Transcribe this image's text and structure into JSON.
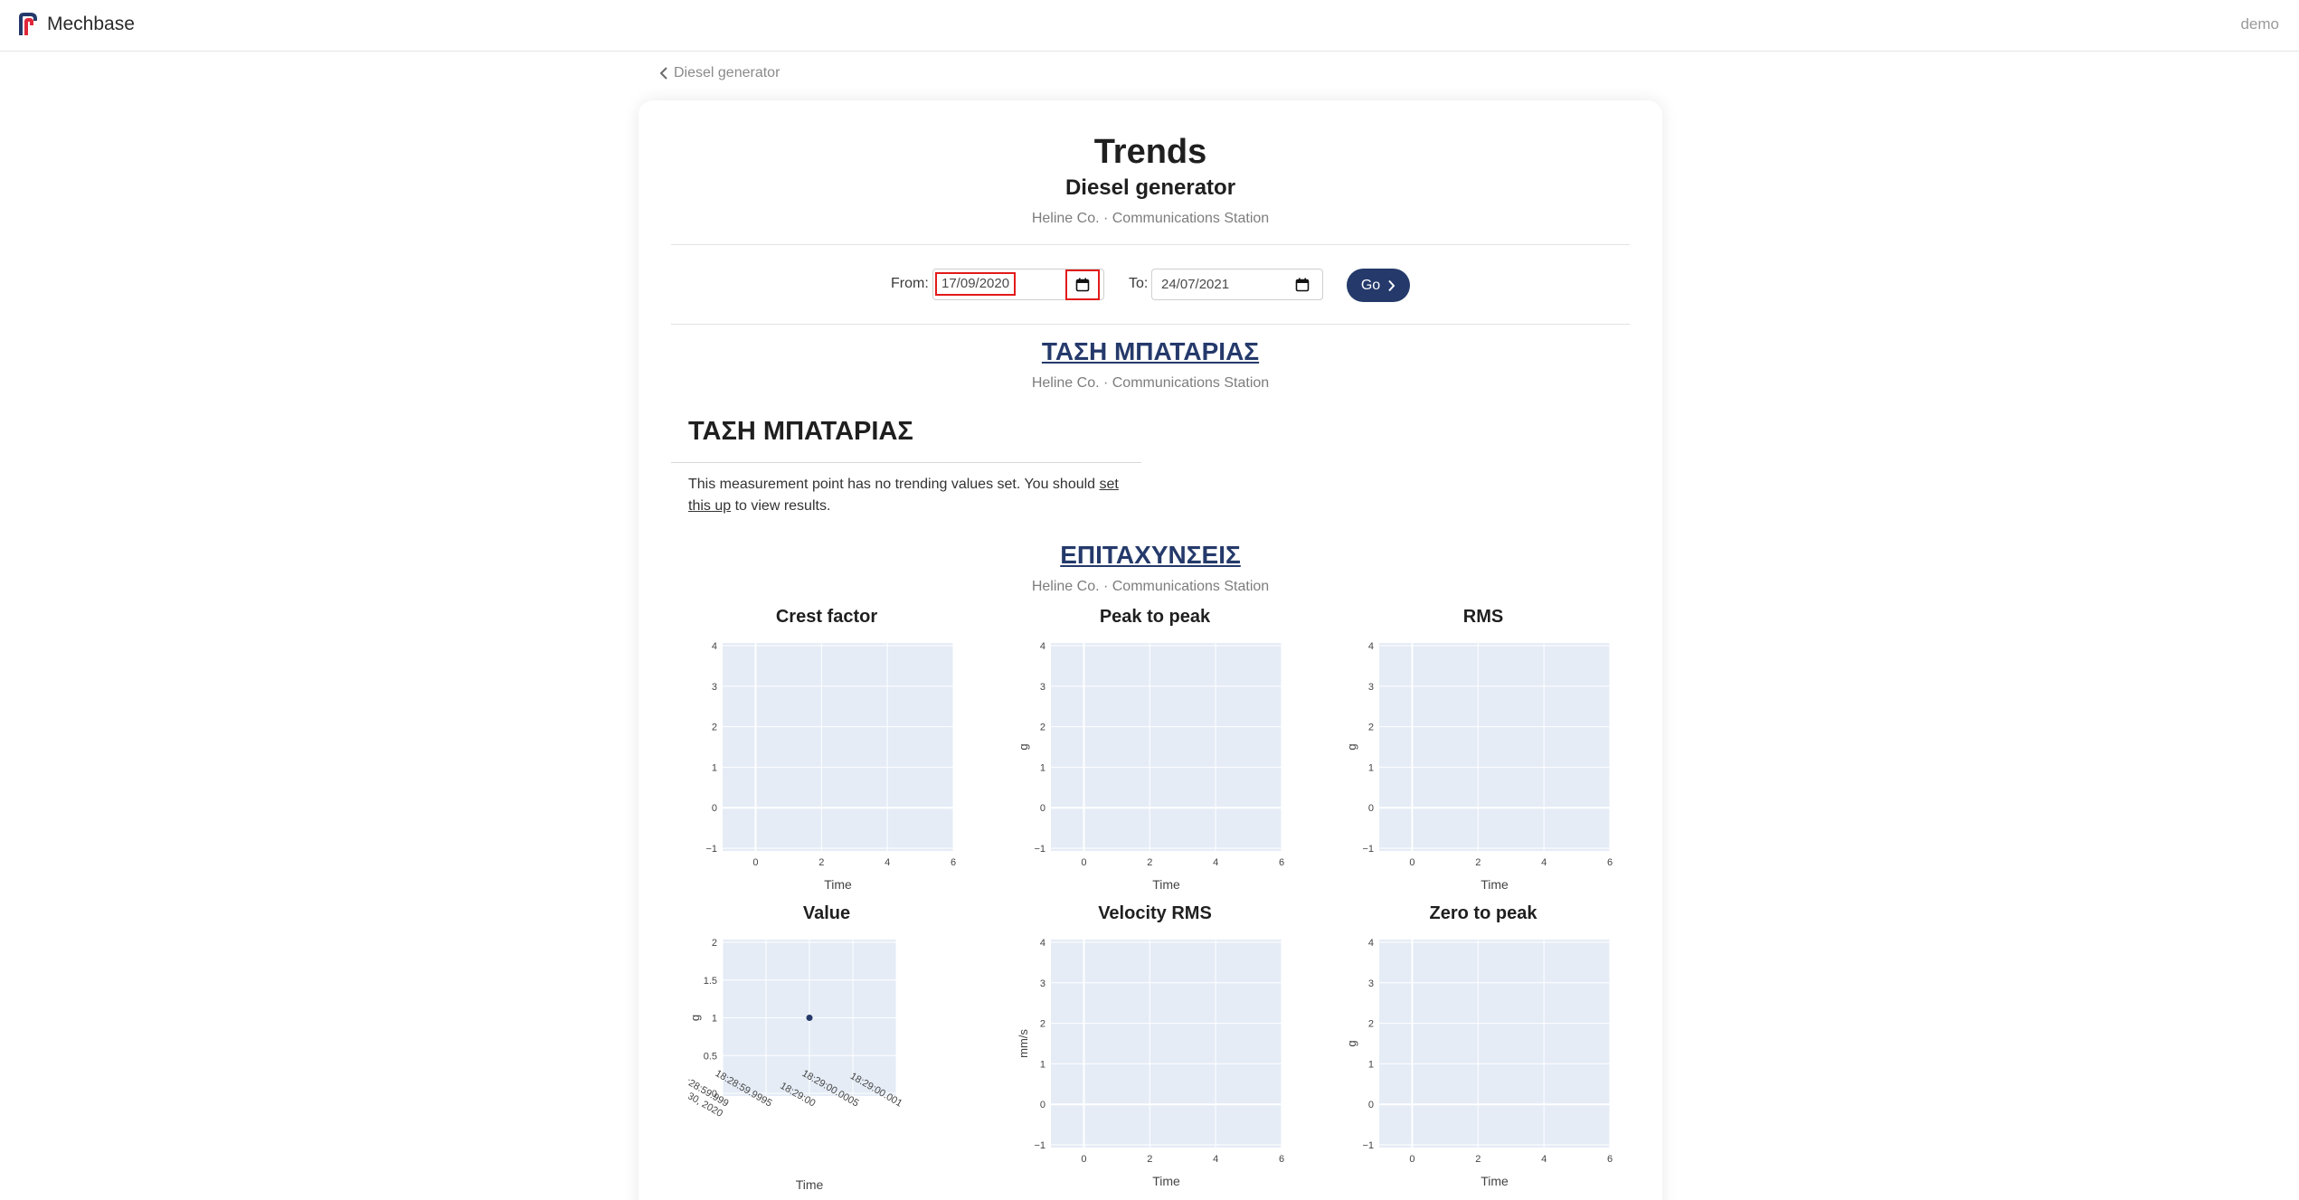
{
  "navbar": {
    "brand": "Mechbase",
    "user": "demo"
  },
  "breadcrumb": {
    "back_label": "Diesel generator"
  },
  "header": {
    "title": "Trends",
    "asset": "Diesel generator",
    "location": "Heline Co. · Communications Station"
  },
  "filters": {
    "from_label": "From:",
    "from_value": "17/09/2020",
    "to_label": "To:",
    "to_value": "24/07/2021",
    "go_label": "Go"
  },
  "sections": [
    {
      "title": "ΤΑΣΗ ΜΠΑΤΑΡΙΑΣ",
      "location": "Heline Co. · Communications Station",
      "measurement_point": "ΤΑΣΗ ΜΠΑΤΑΡΙΑΣ",
      "message_before": "This measurement point has no trending values set. You should ",
      "message_link": "set this up",
      "message_after": " to view results."
    },
    {
      "title": "ΕΠΙΤΑΧΥΝΣΕΙΣ",
      "location": "Heline Co. · Communications Station"
    }
  ],
  "chart_data": [
    {
      "type": "scatter",
      "title": "Crest factor",
      "xlabel": "Time",
      "ylabel": "",
      "xticks": [
        "0",
        "2",
        "4",
        "6"
      ],
      "yticks": [
        "−1",
        "0",
        "1",
        "2",
        "3",
        "4"
      ],
      "xlim": [
        -1,
        6
      ],
      "ylim": [
        -1,
        4
      ],
      "series": []
    },
    {
      "type": "scatter",
      "title": "Peak to peak",
      "xlabel": "Time",
      "ylabel": "g",
      "xticks": [
        "0",
        "2",
        "4",
        "6"
      ],
      "yticks": [
        "−1",
        "0",
        "1",
        "2",
        "3",
        "4"
      ],
      "xlim": [
        -1,
        6
      ],
      "ylim": [
        -1,
        4
      ],
      "series": []
    },
    {
      "type": "scatter",
      "title": "RMS",
      "xlabel": "Time",
      "ylabel": "g",
      "xticks": [
        "0",
        "2",
        "4",
        "6"
      ],
      "yticks": [
        "−1",
        "0",
        "1",
        "2",
        "3",
        "4"
      ],
      "xlim": [
        -1,
        6
      ],
      "ylim": [
        -1,
        4
      ],
      "series": []
    },
    {
      "type": "scatter",
      "title": "Value",
      "xlabel": "Time",
      "ylabel": "g",
      "xticks": [
        "18:28:59.999\nSep 30, 2020",
        "18:28:59.9995",
        "18:29:00",
        "18:29:00.0005",
        "18:29:00.001"
      ],
      "yticks": [
        "0",
        "0.5",
        "1",
        "1.5",
        "2"
      ],
      "ylim": [
        0,
        2
      ],
      "series": [
        {
          "x": [
            "18:29:00"
          ],
          "y": [
            1
          ]
        }
      ]
    },
    {
      "type": "scatter",
      "title": "Velocity RMS",
      "xlabel": "Time",
      "ylabel": "mm/s",
      "xticks": [
        "0",
        "2",
        "4",
        "6"
      ],
      "yticks": [
        "−1",
        "0",
        "1",
        "2",
        "3",
        "4"
      ],
      "xlim": [
        -1,
        6
      ],
      "ylim": [
        -1,
        4
      ],
      "series": []
    },
    {
      "type": "scatter",
      "title": "Zero to peak",
      "xlabel": "Time",
      "ylabel": "g",
      "xticks": [
        "0",
        "2",
        "4",
        "6"
      ],
      "yticks": [
        "−1",
        "0",
        "1",
        "2",
        "3",
        "4"
      ],
      "xlim": [
        -1,
        6
      ],
      "ylim": [
        -1,
        4
      ],
      "series": []
    }
  ],
  "colors": {
    "accent": "#253a6b",
    "plot_bg": "#e5ecf6",
    "highlight": "#e31a1a"
  }
}
